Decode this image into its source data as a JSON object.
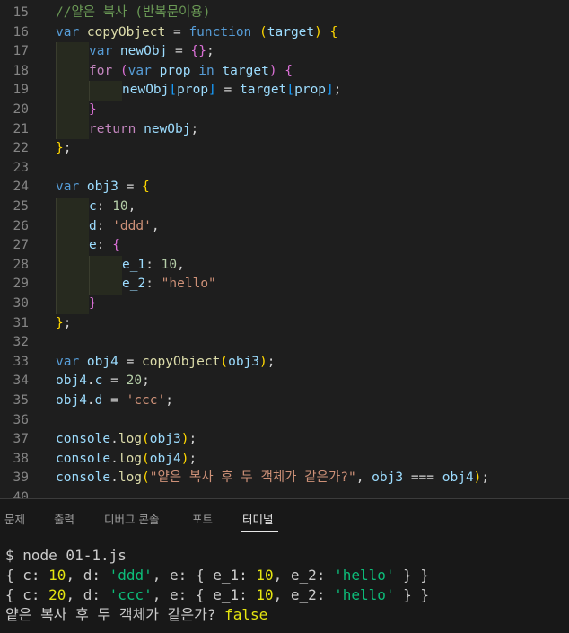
{
  "editor": {
    "lines": [
      {
        "num": "15",
        "segs": [
          {
            "t": "//얕은 복사 (반복문이용)",
            "c": "cmt"
          }
        ],
        "guides": 0
      },
      {
        "num": "16",
        "segs": [
          {
            "t": "var ",
            "c": "kw"
          },
          {
            "t": "copyObject",
            "c": "fn"
          },
          {
            "t": " = ",
            "c": "op"
          },
          {
            "t": "function",
            "c": "kw"
          },
          {
            "t": " ",
            "c": "op"
          },
          {
            "t": "(",
            "c": "b1"
          },
          {
            "t": "target",
            "c": "var"
          },
          {
            "t": ")",
            "c": "b1"
          },
          {
            "t": " ",
            "c": "op"
          },
          {
            "t": "{",
            "c": "b1"
          }
        ],
        "guides": 0
      },
      {
        "num": "17",
        "segs": [
          {
            "t": "var ",
            "c": "kw"
          },
          {
            "t": "newObj",
            "c": "var"
          },
          {
            "t": " = ",
            "c": "op"
          },
          {
            "t": "{}",
            "c": "b2"
          },
          {
            "t": ";",
            "c": "op"
          }
        ],
        "guides": 1
      },
      {
        "num": "18",
        "segs": [
          {
            "t": "for ",
            "c": "ctl"
          },
          {
            "t": "(",
            "c": "b2"
          },
          {
            "t": "var ",
            "c": "kw"
          },
          {
            "t": "prop",
            "c": "var"
          },
          {
            "t": " in ",
            "c": "kw"
          },
          {
            "t": "target",
            "c": "var"
          },
          {
            "t": ")",
            "c": "b2"
          },
          {
            "t": " ",
            "c": "op"
          },
          {
            "t": "{",
            "c": "b2"
          }
        ],
        "guides": 1
      },
      {
        "num": "19",
        "segs": [
          {
            "t": "newObj",
            "c": "var"
          },
          {
            "t": "[",
            "c": "b3"
          },
          {
            "t": "prop",
            "c": "var"
          },
          {
            "t": "]",
            "c": "b3"
          },
          {
            "t": " = ",
            "c": "op"
          },
          {
            "t": "target",
            "c": "var"
          },
          {
            "t": "[",
            "c": "b3"
          },
          {
            "t": "prop",
            "c": "var"
          },
          {
            "t": "]",
            "c": "b3"
          },
          {
            "t": ";",
            "c": "op"
          }
        ],
        "guides": 2
      },
      {
        "num": "20",
        "segs": [
          {
            "t": "}",
            "c": "b2"
          }
        ],
        "guides": 1
      },
      {
        "num": "21",
        "segs": [
          {
            "t": "return ",
            "c": "ctl"
          },
          {
            "t": "newObj",
            "c": "var"
          },
          {
            "t": ";",
            "c": "op"
          }
        ],
        "guides": 1
      },
      {
        "num": "22",
        "segs": [
          {
            "t": "}",
            "c": "b1"
          },
          {
            "t": ";",
            "c": "op"
          }
        ],
        "guides": 0
      },
      {
        "num": "23",
        "segs": [],
        "guides": 0
      },
      {
        "num": "24",
        "segs": [
          {
            "t": "var ",
            "c": "kw"
          },
          {
            "t": "obj3",
            "c": "var"
          },
          {
            "t": " = ",
            "c": "op"
          },
          {
            "t": "{",
            "c": "b1"
          }
        ],
        "guides": 0
      },
      {
        "num": "25",
        "segs": [
          {
            "t": "c",
            "c": "var"
          },
          {
            "t": ": ",
            "c": "op"
          },
          {
            "t": "10",
            "c": "num"
          },
          {
            "t": ",",
            "c": "op"
          }
        ],
        "guides": 1
      },
      {
        "num": "26",
        "segs": [
          {
            "t": "d",
            "c": "var"
          },
          {
            "t": ": ",
            "c": "op"
          },
          {
            "t": "'ddd'",
            "c": "str"
          },
          {
            "t": ",",
            "c": "op"
          }
        ],
        "guides": 1
      },
      {
        "num": "27",
        "segs": [
          {
            "t": "e",
            "c": "var"
          },
          {
            "t": ": ",
            "c": "op"
          },
          {
            "t": "{",
            "c": "b2"
          }
        ],
        "guides": 1
      },
      {
        "num": "28",
        "segs": [
          {
            "t": "e_1",
            "c": "var"
          },
          {
            "t": ": ",
            "c": "op"
          },
          {
            "t": "10",
            "c": "num"
          },
          {
            "t": ",",
            "c": "op"
          }
        ],
        "guides": 2
      },
      {
        "num": "29",
        "segs": [
          {
            "t": "e_2",
            "c": "var"
          },
          {
            "t": ": ",
            "c": "op"
          },
          {
            "t": "\"hello\"",
            "c": "str"
          }
        ],
        "guides": 2
      },
      {
        "num": "30",
        "segs": [
          {
            "t": "}",
            "c": "b2"
          }
        ],
        "guides": 1
      },
      {
        "num": "31",
        "segs": [
          {
            "t": "}",
            "c": "b1"
          },
          {
            "t": ";",
            "c": "op"
          }
        ],
        "guides": 0
      },
      {
        "num": "32",
        "segs": [],
        "guides": 0
      },
      {
        "num": "33",
        "segs": [
          {
            "t": "var ",
            "c": "kw"
          },
          {
            "t": "obj4",
            "c": "var"
          },
          {
            "t": " = ",
            "c": "op"
          },
          {
            "t": "copyObject",
            "c": "fn"
          },
          {
            "t": "(",
            "c": "b1"
          },
          {
            "t": "obj3",
            "c": "var"
          },
          {
            "t": ")",
            "c": "b1"
          },
          {
            "t": ";",
            "c": "op"
          }
        ],
        "guides": 0
      },
      {
        "num": "34",
        "segs": [
          {
            "t": "obj4",
            "c": "var"
          },
          {
            "t": ".",
            "c": "op"
          },
          {
            "t": "c",
            "c": "var"
          },
          {
            "t": " = ",
            "c": "op"
          },
          {
            "t": "20",
            "c": "num"
          },
          {
            "t": ";",
            "c": "op"
          }
        ],
        "guides": 0
      },
      {
        "num": "35",
        "segs": [
          {
            "t": "obj4",
            "c": "var"
          },
          {
            "t": ".",
            "c": "op"
          },
          {
            "t": "d",
            "c": "var"
          },
          {
            "t": " = ",
            "c": "op"
          },
          {
            "t": "'ccc'",
            "c": "str"
          },
          {
            "t": ";",
            "c": "op"
          }
        ],
        "guides": 0
      },
      {
        "num": "36",
        "segs": [],
        "guides": 0
      },
      {
        "num": "37",
        "segs": [
          {
            "t": "console",
            "c": "var"
          },
          {
            "t": ".",
            "c": "op"
          },
          {
            "t": "log",
            "c": "fn"
          },
          {
            "t": "(",
            "c": "b1"
          },
          {
            "t": "obj3",
            "c": "var"
          },
          {
            "t": ")",
            "c": "b1"
          },
          {
            "t": ";",
            "c": "op"
          }
        ],
        "guides": 0
      },
      {
        "num": "38",
        "segs": [
          {
            "t": "console",
            "c": "var"
          },
          {
            "t": ".",
            "c": "op"
          },
          {
            "t": "log",
            "c": "fn"
          },
          {
            "t": "(",
            "c": "b1"
          },
          {
            "t": "obj4",
            "c": "var"
          },
          {
            "t": ")",
            "c": "b1"
          },
          {
            "t": ";",
            "c": "op"
          }
        ],
        "guides": 0
      },
      {
        "num": "39",
        "segs": [
          {
            "t": "console",
            "c": "var"
          },
          {
            "t": ".",
            "c": "op"
          },
          {
            "t": "log",
            "c": "fn"
          },
          {
            "t": "(",
            "c": "b1"
          },
          {
            "t": "\"얕은 복사 후 두 객체가 같은가?\"",
            "c": "str"
          },
          {
            "t": ", ",
            "c": "op"
          },
          {
            "t": "obj3",
            "c": "var"
          },
          {
            "t": " === ",
            "c": "op"
          },
          {
            "t": "obj4",
            "c": "var"
          },
          {
            "t": ")",
            "c": "b1"
          },
          {
            "t": ";",
            "c": "op"
          }
        ],
        "guides": 0
      },
      {
        "num": "40",
        "segs": [],
        "guides": 0
      }
    ]
  },
  "panel": {
    "tabs": [
      {
        "label": "문제",
        "active": false
      },
      {
        "label": "출력",
        "active": false
      },
      {
        "label": "디버그 콘솔",
        "active": false
      },
      {
        "label": "포트",
        "active": false
      },
      {
        "label": "터미널",
        "active": true
      }
    ]
  },
  "terminal": {
    "lines": [
      [
        {
          "t": "$ node 01-1.js",
          "c": ""
        }
      ],
      [
        {
          "t": "{ c: ",
          "c": ""
        },
        {
          "t": "10",
          "c": "t-num"
        },
        {
          "t": ", d: ",
          "c": ""
        },
        {
          "t": "'ddd'",
          "c": "t-str"
        },
        {
          "t": ", e: { e_1: ",
          "c": ""
        },
        {
          "t": "10",
          "c": "t-num"
        },
        {
          "t": ", e_2: ",
          "c": ""
        },
        {
          "t": "'hello'",
          "c": "t-str"
        },
        {
          "t": " } }",
          "c": ""
        }
      ],
      [
        {
          "t": "{ c: ",
          "c": ""
        },
        {
          "t": "20",
          "c": "t-num"
        },
        {
          "t": ", d: ",
          "c": ""
        },
        {
          "t": "'ccc'",
          "c": "t-str"
        },
        {
          "t": ", e: { e_1: ",
          "c": ""
        },
        {
          "t": "10",
          "c": "t-num"
        },
        {
          "t": ", e_2: ",
          "c": ""
        },
        {
          "t": "'hello'",
          "c": "t-str"
        },
        {
          "t": " } }",
          "c": ""
        }
      ],
      [
        {
          "t": "얕은 복사 후 두 객체가 같은가? ",
          "c": ""
        },
        {
          "t": "false",
          "c": "t-bool"
        }
      ]
    ]
  }
}
